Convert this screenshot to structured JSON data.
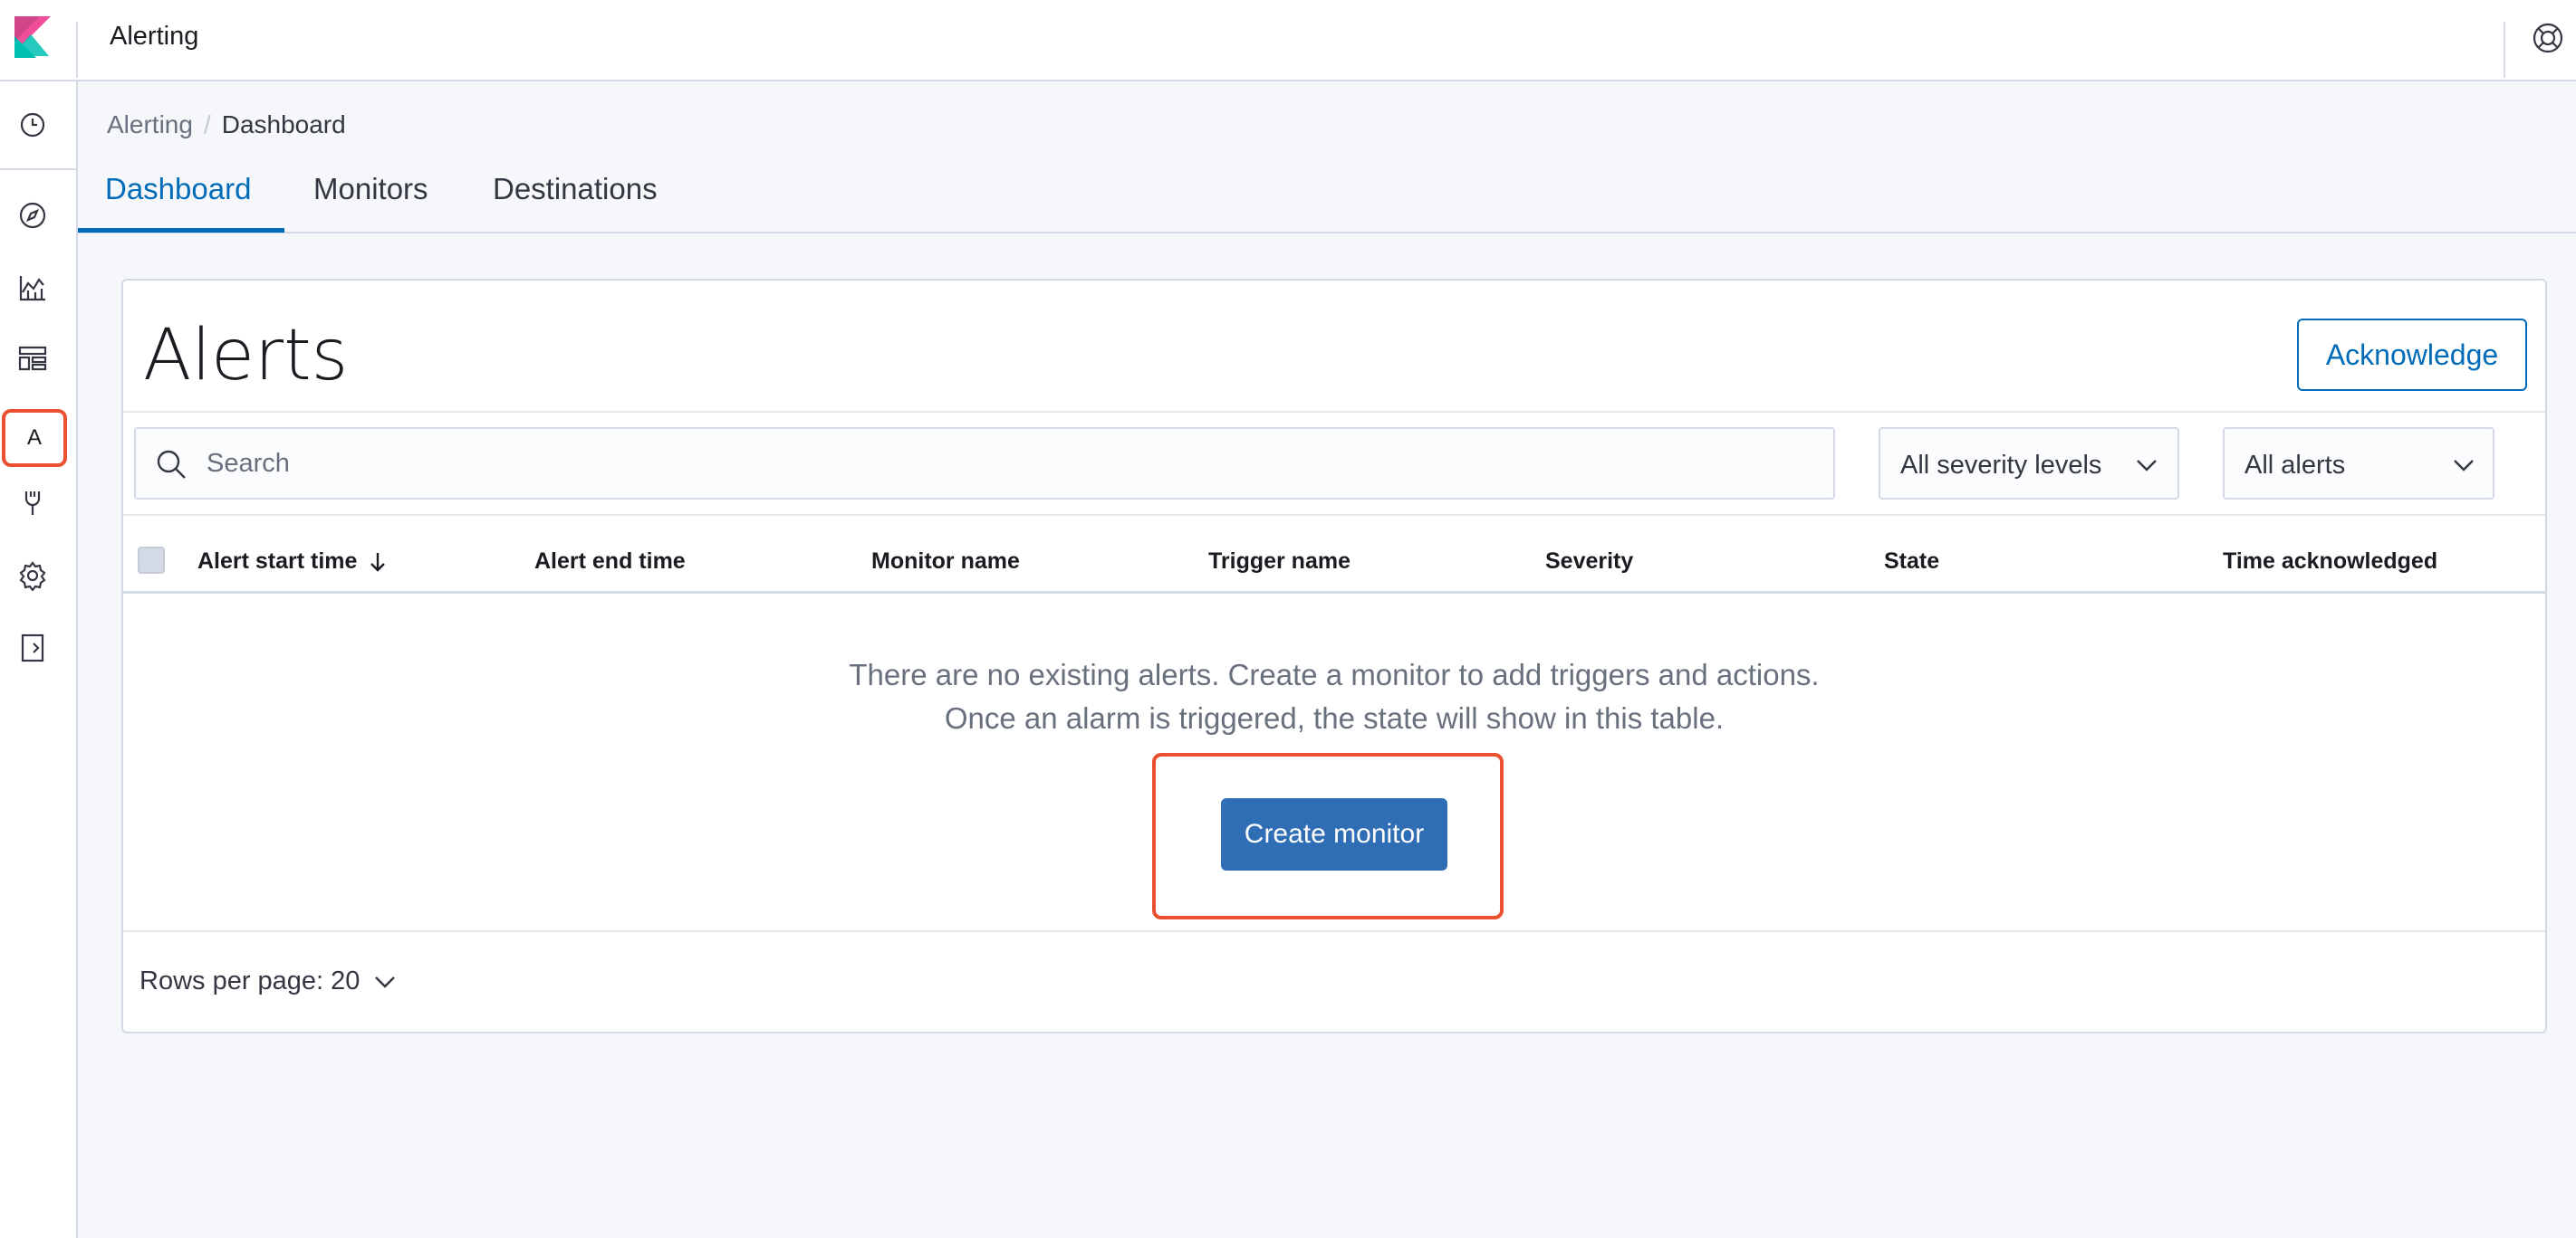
{
  "header": {
    "app_title": "Alerting"
  },
  "nav": {
    "items": [
      {
        "name": "recently-viewed",
        "icon": "clock-icon"
      },
      {
        "name": "discover",
        "icon": "compass-icon"
      },
      {
        "name": "visualize",
        "icon": "chart-icon"
      },
      {
        "name": "dashboard",
        "icon": "dashboard-icon"
      },
      {
        "name": "alerting",
        "icon": "letter-a-icon",
        "label": "A"
      },
      {
        "name": "dev-tools",
        "icon": "wrench-icon"
      },
      {
        "name": "management",
        "icon": "gear-icon"
      },
      {
        "name": "collapse",
        "icon": "collapse-icon"
      }
    ],
    "highlight_color": "#e8502f"
  },
  "breadcrumb": {
    "parent": "Alerting",
    "separator": "/",
    "current": "Dashboard"
  },
  "tabs": [
    {
      "label": "Dashboard",
      "active": true
    },
    {
      "label": "Monitors",
      "active": false
    },
    {
      "label": "Destinations",
      "active": false
    }
  ],
  "panel": {
    "title": "Alerts",
    "acknowledge_label": "Acknowledge",
    "search": {
      "placeholder": "Search",
      "value": ""
    },
    "severity_select": {
      "value": "All severity levels"
    },
    "alerts_select": {
      "value": "All alerts"
    },
    "columns": [
      "Alert start time",
      "Alert end time",
      "Monitor name",
      "Trigger name",
      "Severity",
      "State",
      "Time acknowledged"
    ],
    "empty_message": {
      "line1": "There are no existing alerts. Create a monitor to add triggers and actions.",
      "line2": "Once an alarm is triggered, the state will show in this table."
    },
    "create_monitor_label": "Create monitor",
    "rows_per_page": "Rows per page: 20"
  },
  "colors": {
    "accent": "#006bb8",
    "primary_button": "#2f6db5",
    "annotation": "#e8502f"
  }
}
